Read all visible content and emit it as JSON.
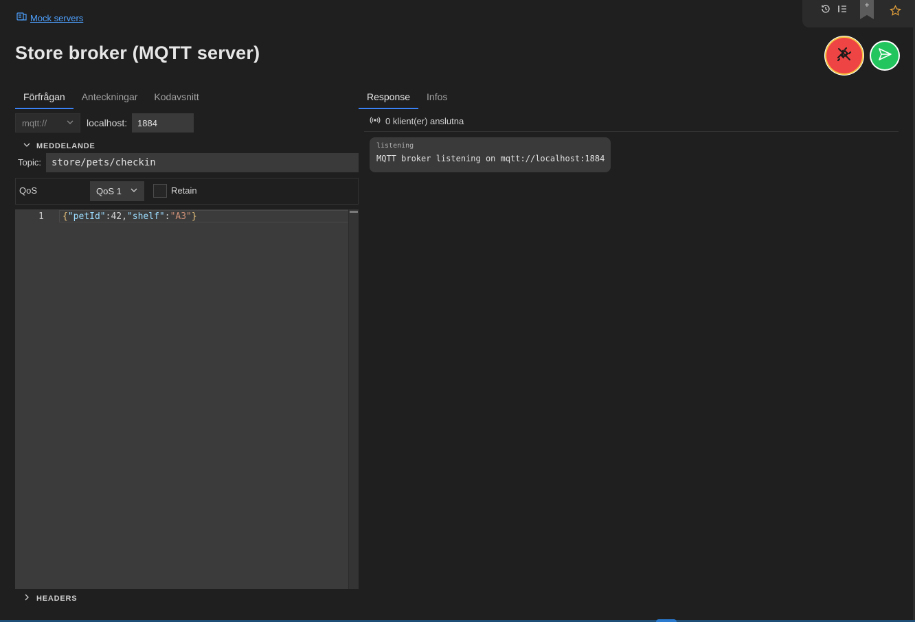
{
  "breadcrumb": {
    "label": "Mock servers",
    "icon": "mock-server-icon"
  },
  "page": {
    "title": "Store broker (MQTT server)"
  },
  "toolbar": {
    "icons": [
      "history-icon",
      "list-icon",
      "bookmark-add-icon",
      "star-icon"
    ],
    "bookmark_symbol": "+"
  },
  "actions": {
    "disconnect": {
      "icon": "plug-disconnect-icon",
      "color": "#ef4444"
    },
    "send": {
      "icon": "send-icon",
      "color": "#22c55e"
    }
  },
  "request_tabs": [
    {
      "label": "Förfrågan",
      "active": true
    },
    {
      "label": "Anteckningar",
      "active": false
    },
    {
      "label": "Kodavsnitt",
      "active": false
    }
  ],
  "response_tabs": [
    {
      "label": "Response",
      "active": true
    },
    {
      "label": "Infos",
      "active": false
    }
  ],
  "connection": {
    "scheme": "mqtt://",
    "host_label": "localhost:",
    "port": "1884"
  },
  "message": {
    "section_label": "MEDDELANDE",
    "topic_label": "Topic:",
    "topic_value": "store/pets/checkin",
    "qos_label": "QoS",
    "qos_value": "QoS 1",
    "retain_label": "Retain",
    "retain_checked": false
  },
  "editor": {
    "line_number": "1",
    "tokens": [
      "{",
      "\"petId\"",
      ":",
      "42",
      ",",
      "\"shelf\"",
      ":",
      "\"A3\"",
      "}"
    ]
  },
  "headers_section": {
    "label": "HEADERS"
  },
  "response": {
    "clients_text": "0 klient(er) anslutna",
    "log": {
      "tag": "listening",
      "message": "MQTT broker listening on mqtt://localhost:1884"
    }
  },
  "colors": {
    "accent": "#3b82f6",
    "link": "#4ea1ff",
    "background": "#1f1f1f"
  }
}
